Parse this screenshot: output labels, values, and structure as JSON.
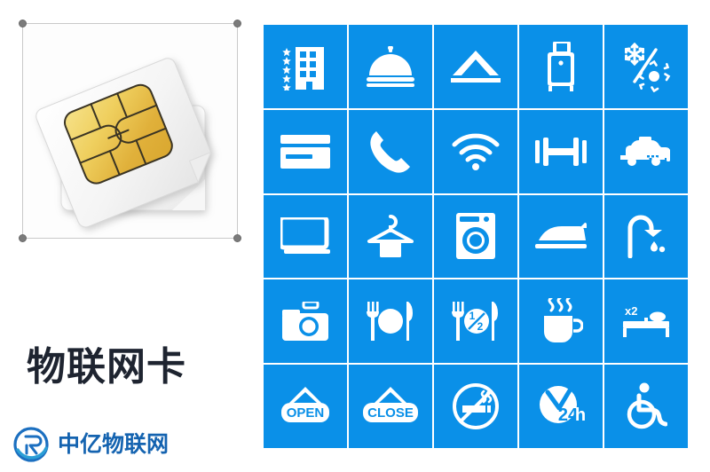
{
  "left": {
    "image_alt": "sim-card-photo",
    "product_title": "物联网卡",
    "brand_name": "中亿物联网",
    "brand_logo": "zhongyi-circle-logo"
  },
  "grid": {
    "tile_color": "#0a90e8",
    "icon_color": "#ffffff",
    "columns": 5,
    "rows": 5,
    "tiles": [
      {
        "name": "hotel-stars-icon",
        "label": "Star Hotel"
      },
      {
        "name": "room-service-bell-icon",
        "label": "Room Service"
      },
      {
        "name": "tent-camping-icon",
        "label": "Camping"
      },
      {
        "name": "luggage-icon",
        "label": "Luggage"
      },
      {
        "name": "air-conditioning-icon",
        "label": "Air Conditioning"
      },
      {
        "name": "credit-card-icon",
        "label": "Credit Card"
      },
      {
        "name": "telephone-icon",
        "label": "Telephone"
      },
      {
        "name": "wifi-icon",
        "label": "Wi-Fi"
      },
      {
        "name": "dumbbell-gym-icon",
        "label": "Gym"
      },
      {
        "name": "taxi-icon",
        "label": "Taxi"
      },
      {
        "name": "television-icon",
        "label": "Television"
      },
      {
        "name": "clothes-hanger-icon",
        "label": "Laundry Service"
      },
      {
        "name": "washing-machine-icon",
        "label": "Washing Machine"
      },
      {
        "name": "iron-icon",
        "label": "Iron"
      },
      {
        "name": "shower-icon",
        "label": "Shower"
      },
      {
        "name": "camera-icon",
        "label": "Camera"
      },
      {
        "name": "restaurant-icon",
        "label": "Restaurant"
      },
      {
        "name": "half-board-icon",
        "label": "Half Board",
        "text": "1/2"
      },
      {
        "name": "coffee-cup-icon",
        "label": "Coffee"
      },
      {
        "name": "double-bed-icon",
        "label": "Double Bed",
        "text": "x2"
      },
      {
        "name": "open-sign-icon",
        "label": "Open",
        "text": "OPEN"
      },
      {
        "name": "close-sign-icon",
        "label": "Close",
        "text": "CLOSE"
      },
      {
        "name": "no-smoking-icon",
        "label": "No Smoking"
      },
      {
        "name": "clock-24h-icon",
        "label": "24 Hours",
        "text": "24h"
      },
      {
        "name": "wheelchair-access-icon",
        "label": "Accessible"
      }
    ]
  }
}
